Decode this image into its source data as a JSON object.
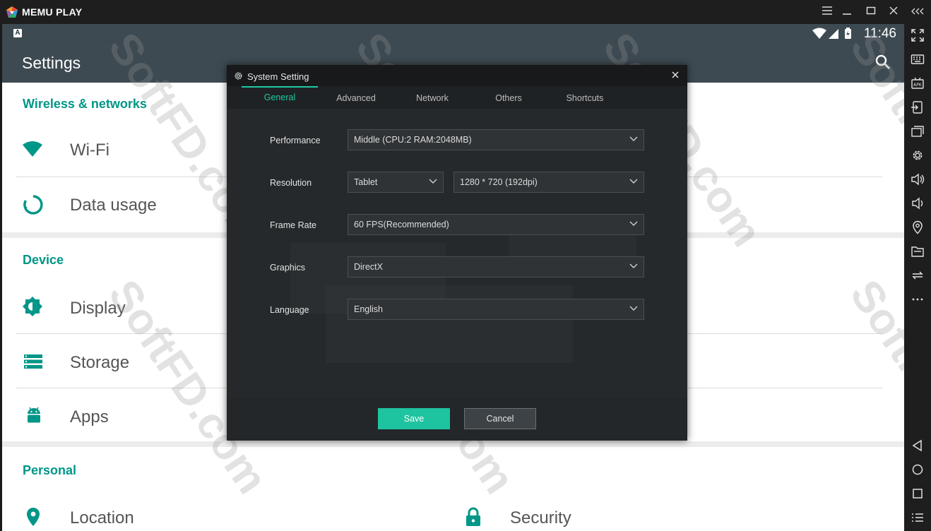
{
  "window": {
    "brand": "MEMU PLAY",
    "controls": {
      "menu": "menu-icon",
      "minimize": "minimize-icon",
      "maximize": "maximize-icon",
      "close": "close-icon",
      "collapse": "collapse-icon"
    }
  },
  "statusbar": {
    "clock": "11:46"
  },
  "settings": {
    "title": "Settings",
    "sections": {
      "wireless": {
        "title": "Wireless & networks",
        "items": [
          "Wi-Fi",
          "Data usage"
        ]
      },
      "device": {
        "title": "Device",
        "items": [
          "Display",
          "Storage",
          "Apps"
        ]
      },
      "personal": {
        "title": "Personal",
        "items": [
          "Location",
          "Security"
        ]
      }
    }
  },
  "watermark": "SoftFD.com",
  "dialog": {
    "title": "System Setting",
    "tabs": [
      "General",
      "Advanced",
      "Network",
      "Others",
      "Shortcuts"
    ],
    "active_tab": "General",
    "fields": {
      "performance": {
        "label": "Performance",
        "value": "Middle (CPU:2 RAM:2048MB)"
      },
      "resolution": {
        "label": "Resolution",
        "mode": "Tablet",
        "value": "1280 * 720 (192dpi)"
      },
      "frame_rate": {
        "label": "Frame Rate",
        "value": "60 FPS(Recommended)"
      },
      "graphics": {
        "label": "Graphics",
        "value": "DirectX"
      },
      "language": {
        "label": "Language",
        "value": "English"
      }
    },
    "save_label": "Save",
    "cancel_label": "Cancel"
  },
  "colors": {
    "accent": "#1fc8a3",
    "android_teal": "#009688",
    "appbar": "#3d4a51"
  }
}
